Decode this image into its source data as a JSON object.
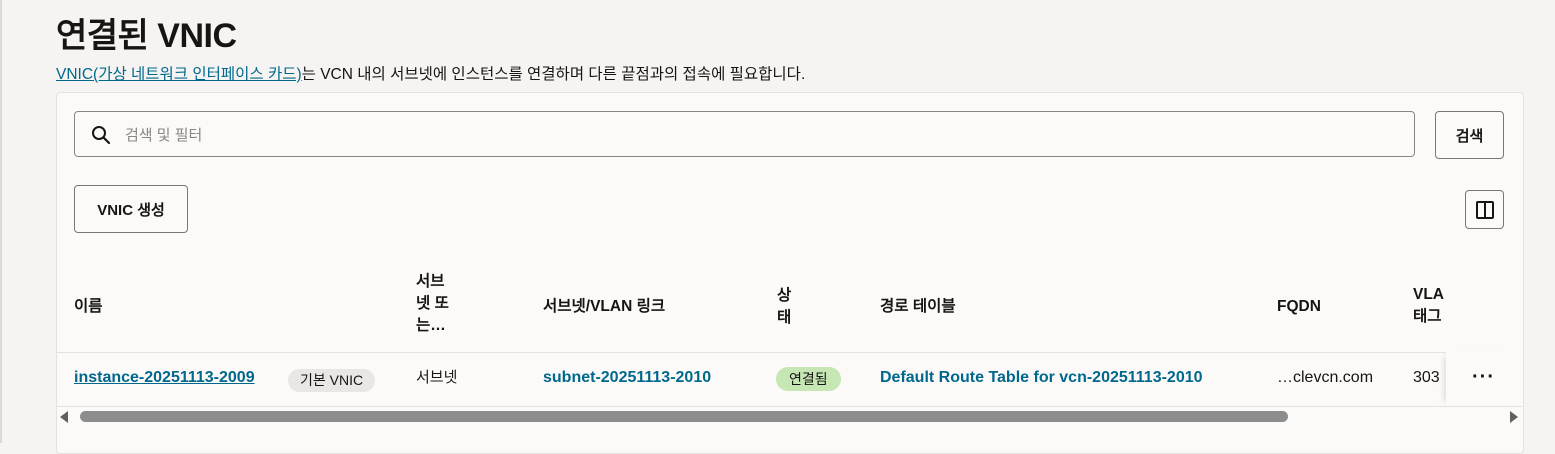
{
  "page": {
    "title": "연결된 VNIC",
    "description_link": "VNIC(가상 네트워크 인터페이스 카드)",
    "description_rest": "는 VCN 내의 서브넷에 인스턴스를 연결하며 다른 끝점과의 접속에 필요합니다."
  },
  "search": {
    "placeholder": "검색 및 필터",
    "button_label": "검색"
  },
  "toolbar": {
    "create_label": "VNIC 생성"
  },
  "table": {
    "headers": {
      "name": "이름",
      "subnet_or": "서브\n넷 또\n는…",
      "subnet_link": "서브넷/VLAN 링크",
      "status": "상\n태",
      "route_table": "경로 테이블",
      "fqdn": "FQDN",
      "vlan_tag": "VLA\n태그"
    },
    "rows": [
      {
        "name": "instance-20251113-2009",
        "badge": "기본 VNIC",
        "subnet_or": "서브넷",
        "subnet_link": "subnet-20251113-2010",
        "status": "연결됨",
        "route_table": "Default Route Table for vcn-20251113-2010",
        "fqdn": "…clevcn.com",
        "vlan_tag": "303",
        "actions": "···"
      }
    ]
  },
  "colors": {
    "link": "#00688c",
    "status_green": "#c6e6b3",
    "badge_grey": "#e9e7e3"
  }
}
